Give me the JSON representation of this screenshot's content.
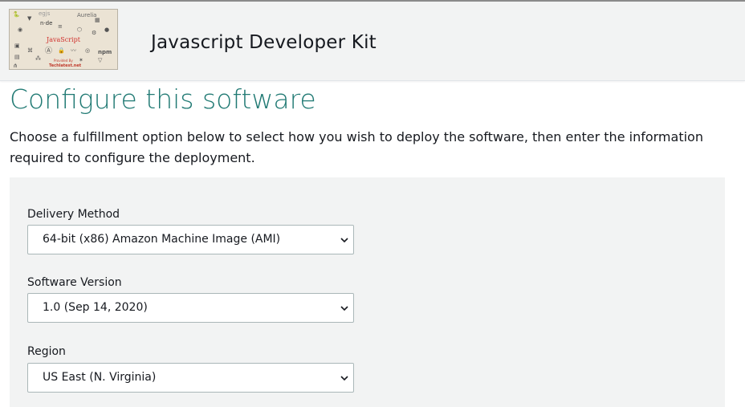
{
  "header": {
    "product_title": "Javascript Developer Kit",
    "logo": {
      "javascript_text": "JavaScript",
      "provided_by_text": "Provided By",
      "site_text": "Techlatest.net"
    }
  },
  "page": {
    "title": "Configure this software",
    "description": "Choose a fulfillment option below to select how you wish to deploy the software, then enter the information required to configure the deployment."
  },
  "form": {
    "delivery_method": {
      "label": "Delivery Method",
      "selected": "64-bit (x86) Amazon Machine Image (AMI)"
    },
    "software_version": {
      "label": "Software Version",
      "selected": "1.0 (Sep 14, 2020)"
    },
    "region": {
      "label": "Region",
      "selected": "US East (N. Virginia)"
    }
  },
  "colors": {
    "title_teal": "#217a74",
    "panel_bg": "#f2f3f3",
    "select_border": "#aab7b8"
  },
  "icons": [
    "chevron-down-icon"
  ]
}
